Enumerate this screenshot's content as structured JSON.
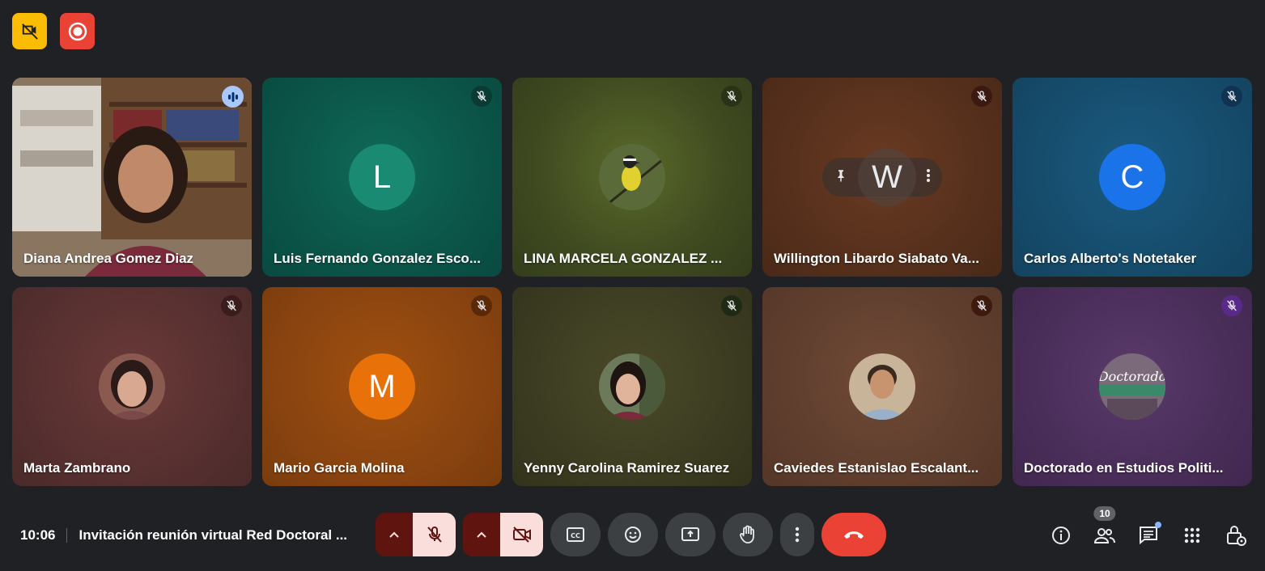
{
  "top_badges": [
    {
      "name": "no-video-badge",
      "color": "#fbbc04"
    },
    {
      "name": "recording-badge",
      "color": "#ea4335"
    }
  ],
  "participants": [
    {
      "name": "Diana Andrea Gomez Diaz",
      "initial": "",
      "kind": "video",
      "state": "speaking"
    },
    {
      "name": "Luis Fernando Gonzalez Esco...",
      "initial": "L",
      "kind": "initial",
      "avatar_color": "#1a8a72",
      "state": "muted"
    },
    {
      "name": "LINA MARCELA GONZALEZ ...",
      "initial": "",
      "kind": "photo-bird",
      "state": "muted"
    },
    {
      "name": "Willington Libardo Siabato Va...",
      "initial": "W",
      "kind": "hover",
      "state": "muted"
    },
    {
      "name": "Carlos Alberto's Notetaker",
      "initial": "C",
      "kind": "initial",
      "avatar_color": "#1a73e8",
      "state": "muted"
    },
    {
      "name": "Marta Zambrano",
      "initial": "",
      "kind": "photo",
      "state": "muted"
    },
    {
      "name": "Mario Garcia Molina",
      "initial": "M",
      "kind": "initial",
      "avatar_color": "#e8710a",
      "state": "muted"
    },
    {
      "name": "Yenny Carolina Ramirez Suarez",
      "initial": "",
      "kind": "photo",
      "state": "muted"
    },
    {
      "name": "Caviedes Estanislao Escalant...",
      "initial": "",
      "kind": "photo",
      "state": "muted"
    },
    {
      "name": "Doctorado en Estudios Politi...",
      "initial": "",
      "kind": "logo",
      "logo_text": "Doctorado",
      "state": "muted"
    }
  ],
  "meeting": {
    "time": "10:06",
    "title": "Invitación reunión virtual Red Doctoral ..."
  },
  "controls": {
    "participant_count": "10"
  }
}
